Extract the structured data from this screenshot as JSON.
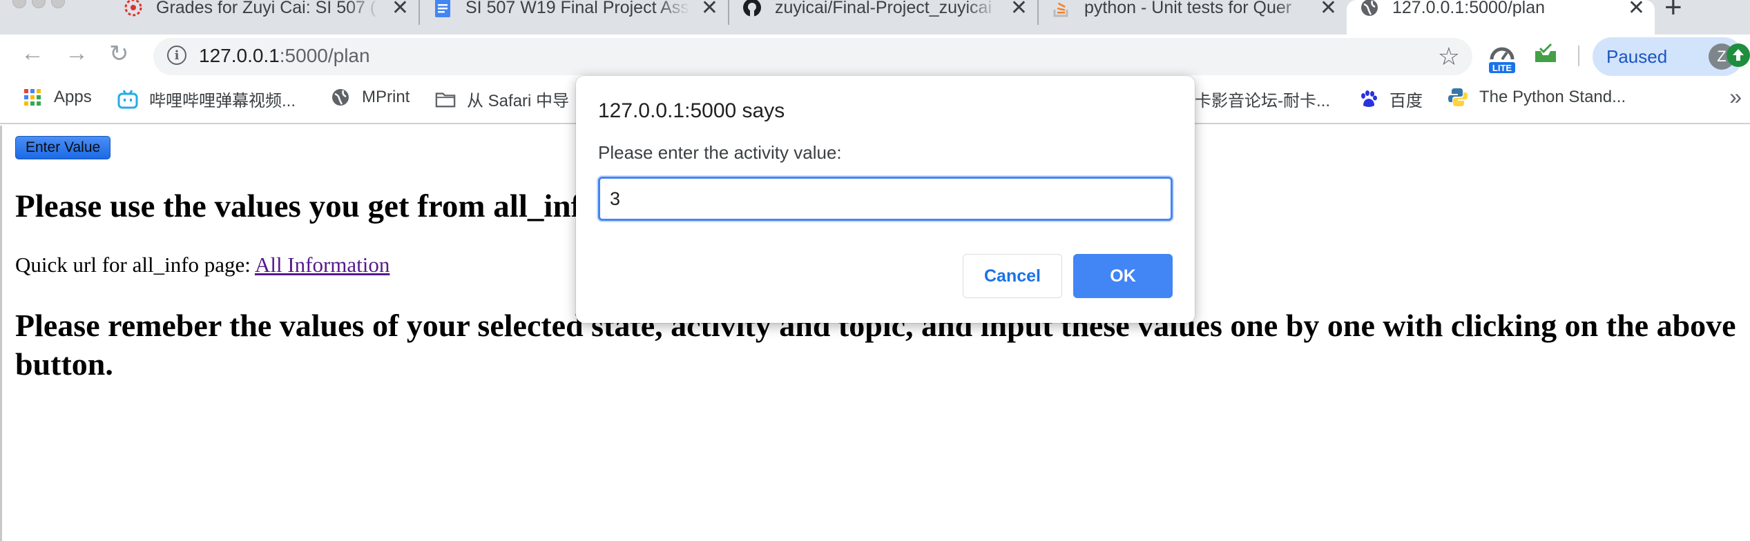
{
  "tabs": [
    {
      "title": "Grades for Zuyi Cai: SI 507 (",
      "icon": "canvas-icon",
      "active": false
    },
    {
      "title": "SI 507 W19 Final Project Ass",
      "icon": "google-docs-icon",
      "active": false
    },
    {
      "title": "zuyicai/Final-Project_zuyicai",
      "icon": "github-icon",
      "active": false
    },
    {
      "title": "python - Unit tests for Quer",
      "icon": "stackoverflow-icon",
      "active": false
    },
    {
      "title": "127.0.0.1:5000/plan",
      "icon": "globe-icon",
      "active": true
    }
  ],
  "toolbar": {
    "url_host": "127.0.0.1",
    "url_path": ":5000/plan",
    "ext_badge": "LITE",
    "profile_label": "Paused",
    "profile_initial": "Z"
  },
  "bookmarks": [
    {
      "label": "Apps",
      "icon": "apps-grid-icon"
    },
    {
      "label": "哔哩哔哩弹幕视频...",
      "icon": "bilibili-icon"
    },
    {
      "label": "MPrint",
      "icon": "globe-icon"
    },
    {
      "label": "从 Safari 中导",
      "icon": "folder-icon"
    },
    {
      "label": "卡影音论坛-耐卡...",
      "icon": ""
    },
    {
      "label": "百度",
      "icon": "baidu-icon"
    },
    {
      "label": "The Python Stand...",
      "icon": "python-icon"
    }
  ],
  "page": {
    "enter_button": "Enter Value",
    "heading": "Please use the values you get from all_info page",
    "quick_prefix": "Quick url for all_info page: ",
    "quick_link": "All Information",
    "instructions": "Please remeber the values of your selected state, activity and topic, and input these values one by one with clicking on the above button."
  },
  "dialog": {
    "title": "127.0.0.1:5000 says",
    "message": "Please enter the activity value:",
    "input_value": "3",
    "cancel_label": "Cancel",
    "ok_label": "OK"
  },
  "colors": {
    "accent": "#4285f4",
    "link_visited": "#551a8b",
    "tab_strip": "#dee1e6"
  }
}
